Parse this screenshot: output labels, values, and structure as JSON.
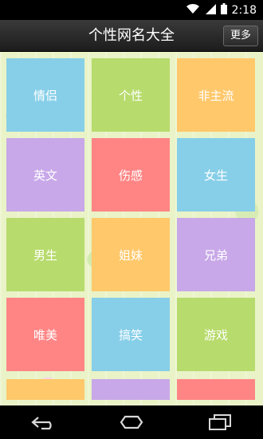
{
  "status_bar": {
    "time": "2:18"
  },
  "app_bar": {
    "title": "个性网名大全",
    "more_label": "更多"
  },
  "categories": [
    {
      "label": "情侣",
      "color": "#87cfe8"
    },
    {
      "label": "个性",
      "color": "#b7db6c"
    },
    {
      "label": "非主流",
      "color": "#ffc86b"
    },
    {
      "label": "英文",
      "color": "#c8a8e8"
    },
    {
      "label": "伤感",
      "color": "#ff8585"
    },
    {
      "label": "女生",
      "color": "#87cfe8"
    },
    {
      "label": "男生",
      "color": "#b7db6c"
    },
    {
      "label": "姐妹",
      "color": "#ffc86b"
    },
    {
      "label": "兄弟",
      "color": "#c8a8e8"
    },
    {
      "label": "唯美",
      "color": "#ff8585"
    },
    {
      "label": "搞笑",
      "color": "#87cfe8"
    },
    {
      "label": "游戏",
      "color": "#b7db6c"
    },
    {
      "label": "",
      "color": "#ffc86b"
    },
    {
      "label": "",
      "color": "#c8a8e8"
    },
    {
      "label": "",
      "color": "#ff8585"
    }
  ],
  "icons": {
    "wifi": "wifi-icon",
    "signal": "signal-icon",
    "battery": "battery-icon",
    "back": "back-icon",
    "home": "home-icon",
    "recents": "recents-icon"
  }
}
